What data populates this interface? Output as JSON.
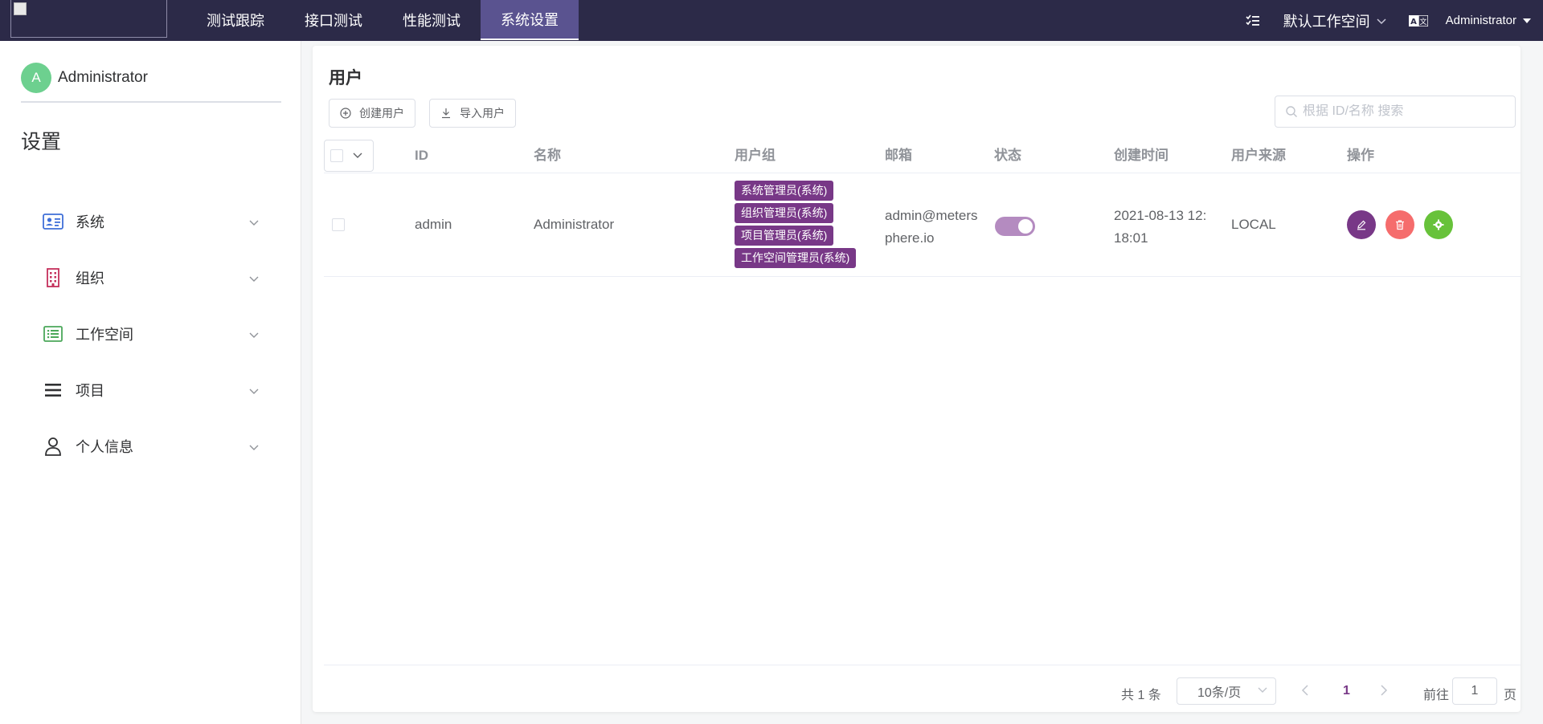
{
  "topbar": {
    "nav": [
      {
        "label": "测试跟踪",
        "active": false
      },
      {
        "label": "接口测试",
        "active": false
      },
      {
        "label": "性能测试",
        "active": false
      },
      {
        "label": "系统设置",
        "active": true
      }
    ],
    "workspace": "默认工作空间",
    "user": "Administrator",
    "bg_color": "#2c2a48",
    "active_color": "#5a5390"
  },
  "sidebar": {
    "avatar_letter": "A",
    "user_name": "Administrator",
    "title": "设置",
    "menu": [
      {
        "label": "系统",
        "icon": "id-card-icon"
      },
      {
        "label": "组织",
        "icon": "building-icon"
      },
      {
        "label": "工作空间",
        "icon": "list-icon"
      },
      {
        "label": "项目",
        "icon": "menu-icon"
      },
      {
        "label": "个人信息",
        "icon": "user-icon"
      }
    ]
  },
  "main": {
    "title": "用户",
    "create_button": "创建用户",
    "import_button": "导入用户",
    "search_placeholder": "根据 ID/名称 搜索",
    "columns": {
      "id": "ID",
      "name": "名称",
      "groups": "用户组",
      "email": "邮箱",
      "status": "状态",
      "created": "创建时间",
      "source": "用户来源",
      "actions": "操作"
    },
    "rows": [
      {
        "id": "admin",
        "name": "Administrator",
        "groups": [
          "系统管理员(系统)",
          "组织管理员(系统)",
          "项目管理员(系统)",
          "工作空间管理员(系统)"
        ],
        "email_line1": "admin@meters",
        "email_line2": "phere.io",
        "enabled": true,
        "created_line1": "2021-08-13 12:",
        "created_line2": "18:01",
        "source": "LOCAL"
      }
    ],
    "pagination": {
      "total": "共 1 条",
      "page_size": "10条/页",
      "current_page": "1",
      "goto_label": "前往",
      "goto_value": "1",
      "page_unit": "页"
    },
    "accent_color": "#783887"
  }
}
